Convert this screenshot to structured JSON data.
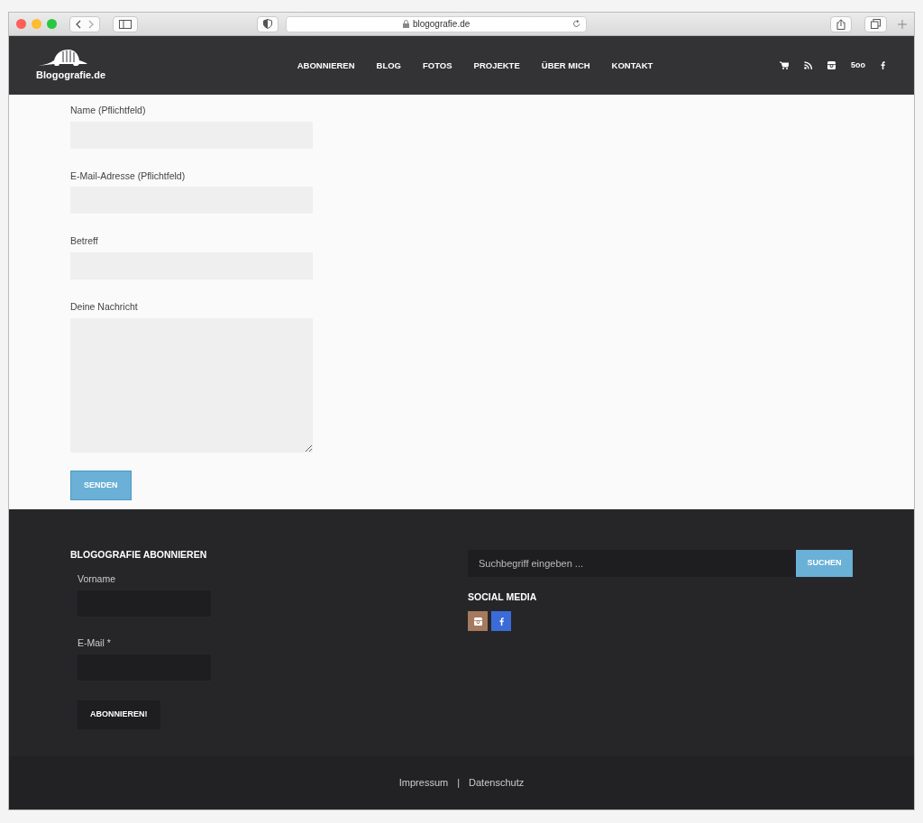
{
  "browser": {
    "url": "blogografie.de"
  },
  "header": {
    "logo": "Blogografie.de",
    "nav": [
      {
        "label": "ABONNIEREN"
      },
      {
        "label": "BLOG"
      },
      {
        "label": "FOTOS"
      },
      {
        "label": "PROJEKTE"
      },
      {
        "label": "ÜBER MICH"
      },
      {
        "label": "KONTAKT"
      }
    ],
    "icons": [
      {
        "kind": "cart"
      },
      {
        "kind": "rss"
      },
      {
        "kind": "instagram"
      },
      {
        "kind": "text",
        "label": "5oo"
      },
      {
        "kind": "facebook"
      }
    ]
  },
  "contact_form": {
    "fields": [
      {
        "label": "Name (Pflichtfeld)",
        "kind": "input"
      },
      {
        "label": "E-Mail-Adresse (Pflichtfeld)",
        "kind": "input"
      },
      {
        "label": "Betreff",
        "kind": "input"
      },
      {
        "label": "Deine Nachricht",
        "kind": "textarea"
      }
    ],
    "submit": "SENDEN"
  },
  "footer": {
    "subscribe": {
      "title": "BLOGOGRAFIE ABONNIEREN",
      "fields": [
        {
          "label": "Vorname"
        },
        {
          "label": "E-Mail *"
        }
      ],
      "button": "ABONNIEREN!"
    },
    "search": {
      "placeholder": "Suchbegriff eingeben ...",
      "button": "SUCHEN"
    },
    "social": {
      "title": "SOCIAL MEDIA",
      "items": [
        {
          "kind": "instagram",
          "color": "#a57a5e"
        },
        {
          "kind": "facebook",
          "color": "#3b6bd6"
        }
      ]
    }
  },
  "bottom_bar": {
    "links": [
      "Impressum",
      "Datenschutz"
    ],
    "separator": "|"
  }
}
